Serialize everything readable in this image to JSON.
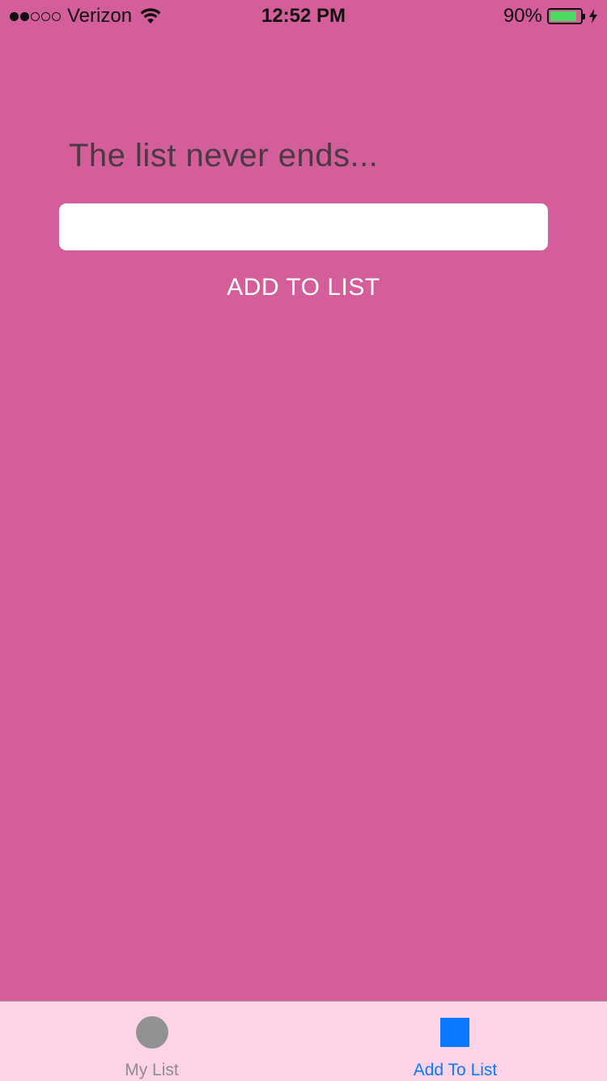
{
  "status_bar": {
    "carrier": "Verizon",
    "time": "12:52 PM",
    "battery_percent_label": "90%",
    "battery_level": 0.9,
    "signal_strength": 2,
    "signal_max": 5,
    "icons": [
      "wifi-icon",
      "battery-icon",
      "charging-bolt-icon"
    ]
  },
  "main": {
    "heading": "The list never ends...",
    "input": {
      "value": "",
      "placeholder": ""
    },
    "add_button_label": "ADD TO LIST"
  },
  "tab_bar": {
    "tabs": [
      {
        "label": "My List",
        "icon": "circle-icon",
        "active": false
      },
      {
        "label": "Add To List",
        "icon": "square-icon",
        "active": true
      }
    ]
  },
  "colors": {
    "background": "#d35e99",
    "tab_bar_background": "#fcd3e7",
    "active_tab": "#0a7aff",
    "inactive_tab": "#8e8e8e",
    "battery_fill": "#4cd964"
  }
}
